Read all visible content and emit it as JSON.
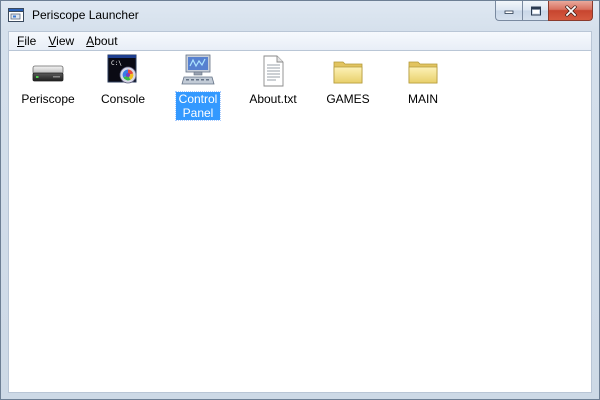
{
  "window": {
    "title": "Periscope Launcher"
  },
  "menu": {
    "items": [
      {
        "label_underlined": "F",
        "label_rest": "ile"
      },
      {
        "label_underlined": "V",
        "label_rest": "iew"
      },
      {
        "label_underlined": "A",
        "label_rest": "bout"
      }
    ]
  },
  "desktop": {
    "icons": [
      {
        "label": "Periscope",
        "icon": "drive-icon"
      },
      {
        "label": "Console",
        "icon": "console-icon"
      },
      {
        "label": "Control Panel",
        "icon": "control-panel-icon",
        "selected": true
      },
      {
        "label": "About.txt",
        "icon": "text-file-icon"
      },
      {
        "label": "GAMES",
        "icon": "folder-icon"
      },
      {
        "label": "MAIN",
        "icon": "folder-icon"
      }
    ]
  },
  "colors": {
    "selection": "#3399ff",
    "folder": "#f5e28a",
    "close_button": "#c7452f"
  }
}
